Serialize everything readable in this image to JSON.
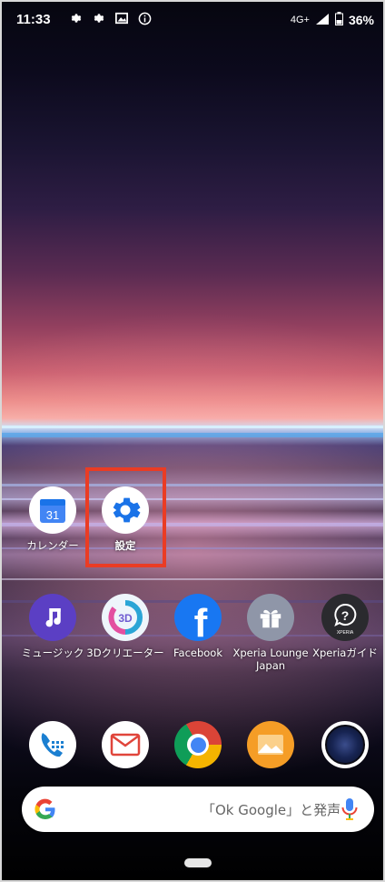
{
  "status_bar": {
    "time": "11:33",
    "icons_left": [
      "gear-icon",
      "gear-icon",
      "photo-icon",
      "info-icon"
    ],
    "network": "4G+",
    "battery": "36%"
  },
  "apps_row1": [
    {
      "name": "calendar",
      "label": "カレンダー",
      "icon_text": "31",
      "icon": "calendar-icon"
    },
    {
      "name": "settings",
      "label": "設定",
      "icon": "gear-icon",
      "highlighted": true
    }
  ],
  "apps_row2": [
    {
      "name": "music",
      "label": "ミュージック",
      "icon": "music-note-icon",
      "color": "#5b3fc4"
    },
    {
      "name": "3d-creator",
      "label": "3Dクリエーター",
      "icon_text": "3D",
      "icon": "3d-creator-icon"
    },
    {
      "name": "facebook",
      "label": "Facebook",
      "icon_text": "f",
      "icon": "facebook-icon",
      "color": "#1877f2"
    },
    {
      "name": "xperia-lounge",
      "label": "Xperia Lounge Japan",
      "icon": "gift-icon"
    },
    {
      "name": "xperia-guide",
      "label": "Xperiaガイド",
      "icon_text": "?",
      "icon_subtext": "XPERIA",
      "icon": "help-icon"
    }
  ],
  "dock": [
    {
      "name": "phone",
      "icon": "phone-icon"
    },
    {
      "name": "email",
      "icon": "mail-icon"
    },
    {
      "name": "chrome",
      "icon": "chrome-icon"
    },
    {
      "name": "album",
      "icon": "photo-album-icon"
    },
    {
      "name": "camera",
      "icon": "camera-icon"
    }
  ],
  "search": {
    "hint": "「Ok Google」と発声",
    "left_icon": "google-g-icon",
    "right_icon": "mic-icon"
  },
  "colors": {
    "highlight": "#ea3c24",
    "facebook": "#1877f2",
    "music": "#5b3fc4"
  }
}
